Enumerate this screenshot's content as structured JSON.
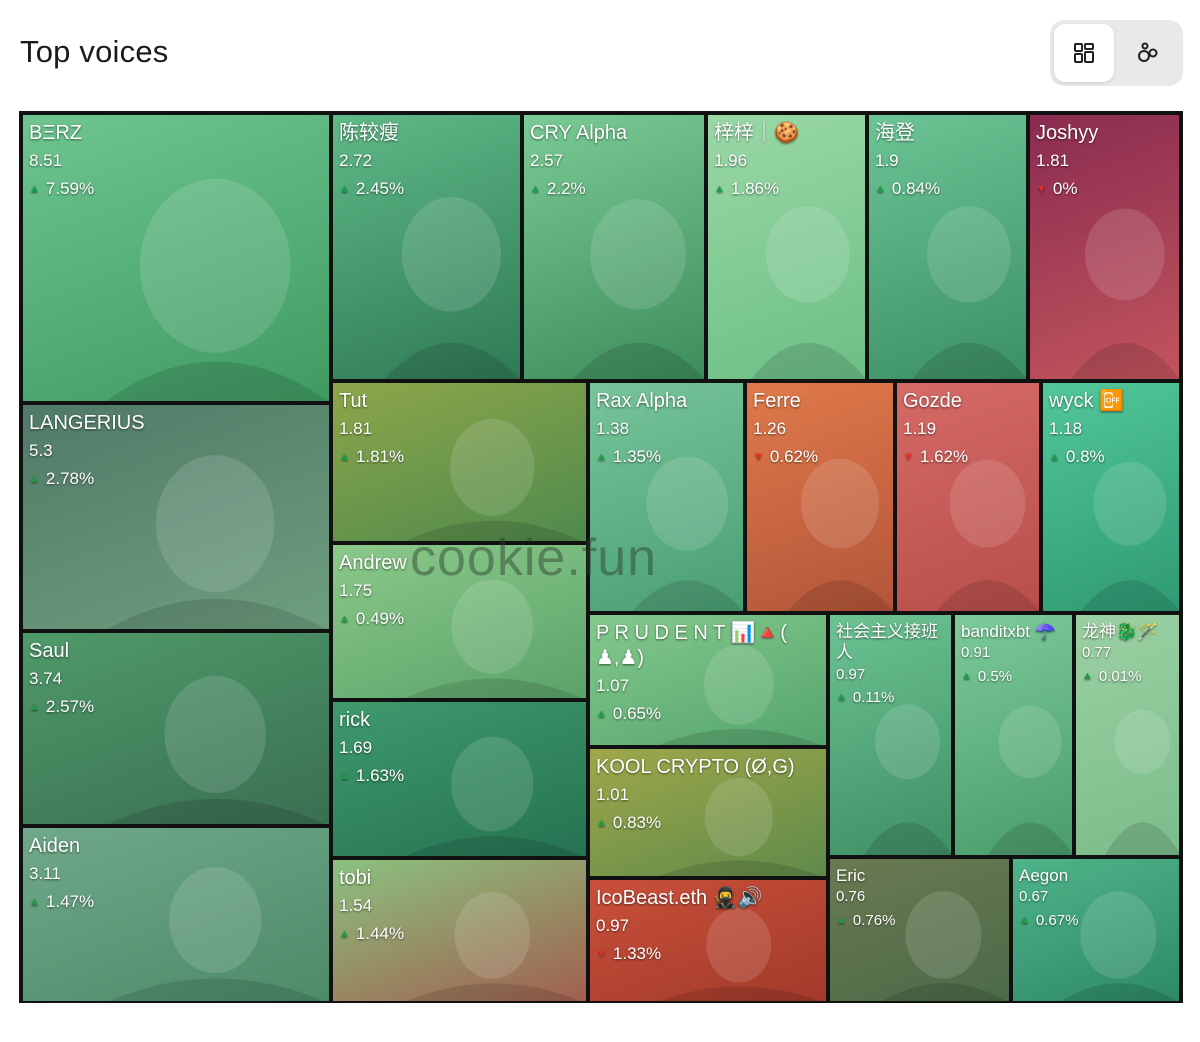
{
  "header": {
    "title": "Top voices",
    "view_toggle": [
      {
        "icon": "grid-icon",
        "active": true
      },
      {
        "icon": "bubbles-icon",
        "active": false
      }
    ]
  },
  "watermark": "cookie.fun",
  "voices": [
    {
      "name": "BΞRZ",
      "score": "8.51",
      "change": "7.59%",
      "dir": "up",
      "bg": [
        "#6ec58f",
        "#3f9a62"
      ],
      "size": "big"
    },
    {
      "name": "陈较瘦",
      "score": "2.72",
      "change": "2.45%",
      "dir": "up",
      "bg": [
        "#5fb987",
        "#2f7a55"
      ]
    },
    {
      "name": "CRY Alpha",
      "score": "2.57",
      "change": "2.2%",
      "dir": "up",
      "bg": [
        "#7acb95",
        "#3d8d5c"
      ]
    },
    {
      "name": "梓梓｜🍪",
      "score": "1.96",
      "change": "1.86%",
      "dir": "up",
      "bg": [
        "#9ad8a6",
        "#6cbf86"
      ]
    },
    {
      "name": "海登",
      "score": "1.9",
      "change": "0.84%",
      "dir": "up",
      "bg": [
        "#6cc595",
        "#3b8f64"
      ]
    },
    {
      "name": "Joshyy",
      "score": "1.81",
      "change": "0%",
      "dir": "down",
      "bg": [
        "#8a2b50",
        "#c2555d"
      ]
    },
    {
      "name": "LANGERIUS",
      "score": "5.3",
      "change": "2.78%",
      "dir": "up",
      "bg": [
        "#507a68",
        "#6e9e7f"
      ],
      "size": "big"
    },
    {
      "name": "Tut",
      "score": "1.81",
      "change": "1.81%",
      "dir": "up",
      "bg": [
        "#8da64a",
        "#4f8a4c"
      ]
    },
    {
      "name": "Rax Alpha",
      "score": "1.38",
      "change": "1.35%",
      "dir": "up",
      "bg": [
        "#77c59a",
        "#4a9e74"
      ]
    },
    {
      "name": "Ferre",
      "score": "1.26",
      "change": "0.62%",
      "dir": "down",
      "bg": [
        "#e07a4a",
        "#b3553a"
      ]
    },
    {
      "name": "Gozde",
      "score": "1.19",
      "change": "1.62%",
      "dir": "down",
      "bg": [
        "#d56a66",
        "#b84e4a"
      ]
    },
    {
      "name": "wyck 📴",
      "score": "1.18",
      "change": "0.8%",
      "dir": "up",
      "bg": [
        "#52c79a",
        "#2f9a73"
      ]
    },
    {
      "name": "Saul",
      "score": "3.74",
      "change": "2.57%",
      "dir": "up",
      "bg": [
        "#4f9a6a",
        "#3a6f52"
      ],
      "size": "big"
    },
    {
      "name": "Andrew",
      "score": "1.75",
      "change": "0.49%",
      "dir": "up",
      "bg": [
        "#8cc989",
        "#5aa36a"
      ]
    },
    {
      "name": "P R U D E N T 📊🔺( ♟,♟)",
      "score": "1.07",
      "change": "0.65%",
      "dir": "up",
      "bg": [
        "#84c98c",
        "#55a56e"
      ]
    },
    {
      "name": "社会主义接班人",
      "score": "0.97",
      "change": "0.11%",
      "dir": "up",
      "bg": [
        "#6cc392",
        "#3f8f65"
      ],
      "size": "small"
    },
    {
      "name": "banditxbt ☂️",
      "score": "0.91",
      "change": "0.5%",
      "dir": "up",
      "bg": [
        "#7ccb9a",
        "#4a9c6c"
      ],
      "size": "small"
    },
    {
      "name": "龙神🐉🪄",
      "score": "0.77",
      "change": "0.01%",
      "dir": "up",
      "bg": [
        "#9bd0a2",
        "#7bbd8b"
      ],
      "size": "small"
    },
    {
      "name": "rick",
      "score": "1.69",
      "change": "1.63%",
      "dir": "up",
      "bg": [
        "#3f9a6d",
        "#257252"
      ]
    },
    {
      "name": "KOOL CRYPTO (Ø,G)",
      "score": "1.01",
      "change": "0.83%",
      "dir": "up",
      "bg": [
        "#9fa84a",
        "#5f8a4a"
      ]
    },
    {
      "name": "Aiden",
      "score": "3.11",
      "change": "1.47%",
      "dir": "up",
      "bg": [
        "#6fa98a",
        "#4d8a68"
      ],
      "size": "big"
    },
    {
      "name": "tobi",
      "score": "1.54",
      "change": "1.44%",
      "dir": "up",
      "bg": [
        "#8bc27f",
        "#a0604e"
      ]
    },
    {
      "name": "IcoBeast.eth 🥷🔊",
      "score": "0.97",
      "change": "1.33%",
      "dir": "down",
      "bg": [
        "#c9503a",
        "#a23a2a"
      ]
    },
    {
      "name": "Eric",
      "score": "0.76",
      "change": "0.76%",
      "dir": "up",
      "bg": [
        "#6a7a52",
        "#4c6a48"
      ],
      "size": "small"
    },
    {
      "name": "Aegon",
      "score": "0.67",
      "change": "0.67%",
      "dir": "up",
      "bg": [
        "#4fb48a",
        "#2d8a66"
      ],
      "size": "small"
    }
  ]
}
